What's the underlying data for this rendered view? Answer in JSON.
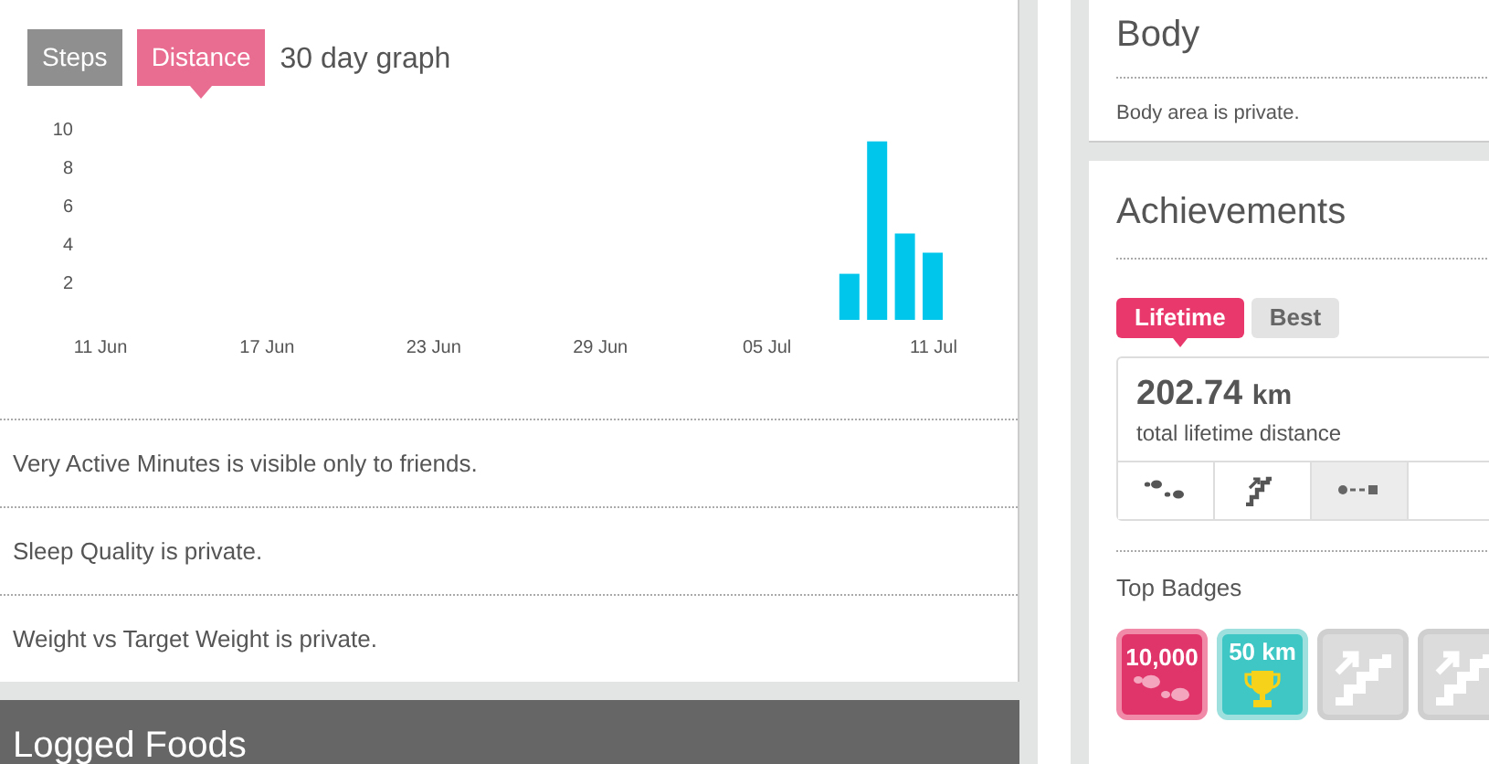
{
  "graph": {
    "tabs": [
      {
        "label": "Steps",
        "selected": false
      },
      {
        "label": "Distance",
        "selected": true
      }
    ],
    "title": "30 day graph",
    "chart_data": {
      "type": "bar",
      "categories": [
        "11 Jun",
        null,
        null,
        null,
        null,
        null,
        "17 Jun",
        null,
        null,
        null,
        null,
        null,
        "23 Jun",
        null,
        null,
        null,
        null,
        null,
        "29 Jun",
        null,
        null,
        null,
        null,
        null,
        "05 Jul",
        null,
        null,
        null,
        null,
        null,
        "11 Jul"
      ],
      "series": [
        {
          "color": "#00c6ec",
          "values": [
            null,
            null,
            null,
            null,
            null,
            null,
            null,
            null,
            null,
            null,
            null,
            null,
            null,
            null,
            null,
            null,
            null,
            null,
            null,
            null,
            null,
            null,
            null,
            null,
            null,
            null,
            null,
            2.4,
            9.3,
            4.5,
            3.5
          ]
        }
      ],
      "ylim": [
        0,
        10
      ],
      "yticks": [
        2,
        4,
        6,
        8,
        10
      ]
    }
  },
  "privacy_notes": [
    "Very Active Minutes is visible only to friends.",
    "Sleep Quality is private.",
    "Weight vs Target Weight is private."
  ],
  "logged_foods": {
    "title": "Logged Foods"
  },
  "body": {
    "title": "Body",
    "note": "Body area is private."
  },
  "achievements": {
    "title": "Achievements",
    "tabs": [
      {
        "label": "Lifetime",
        "selected": true
      },
      {
        "label": "Best",
        "selected": false
      }
    ],
    "value": "202.74",
    "unit": "km",
    "caption": "total lifetime distance",
    "stat_tabs": [
      {
        "kind": "steps",
        "selected": false
      },
      {
        "kind": "floors",
        "selected": false
      },
      {
        "kind": "distance",
        "selected": true
      }
    ],
    "badges_title": "Top Badges",
    "badges": [
      {
        "kind": "steps",
        "label": "10,000",
        "color": "#e0356b"
      },
      {
        "kind": "distance",
        "label": "50 km",
        "color": "#3ec7c4"
      },
      {
        "kind": "floors",
        "color": "#dcdcdc"
      },
      {
        "kind": "floors",
        "color": "#dcdcdc"
      }
    ]
  }
}
